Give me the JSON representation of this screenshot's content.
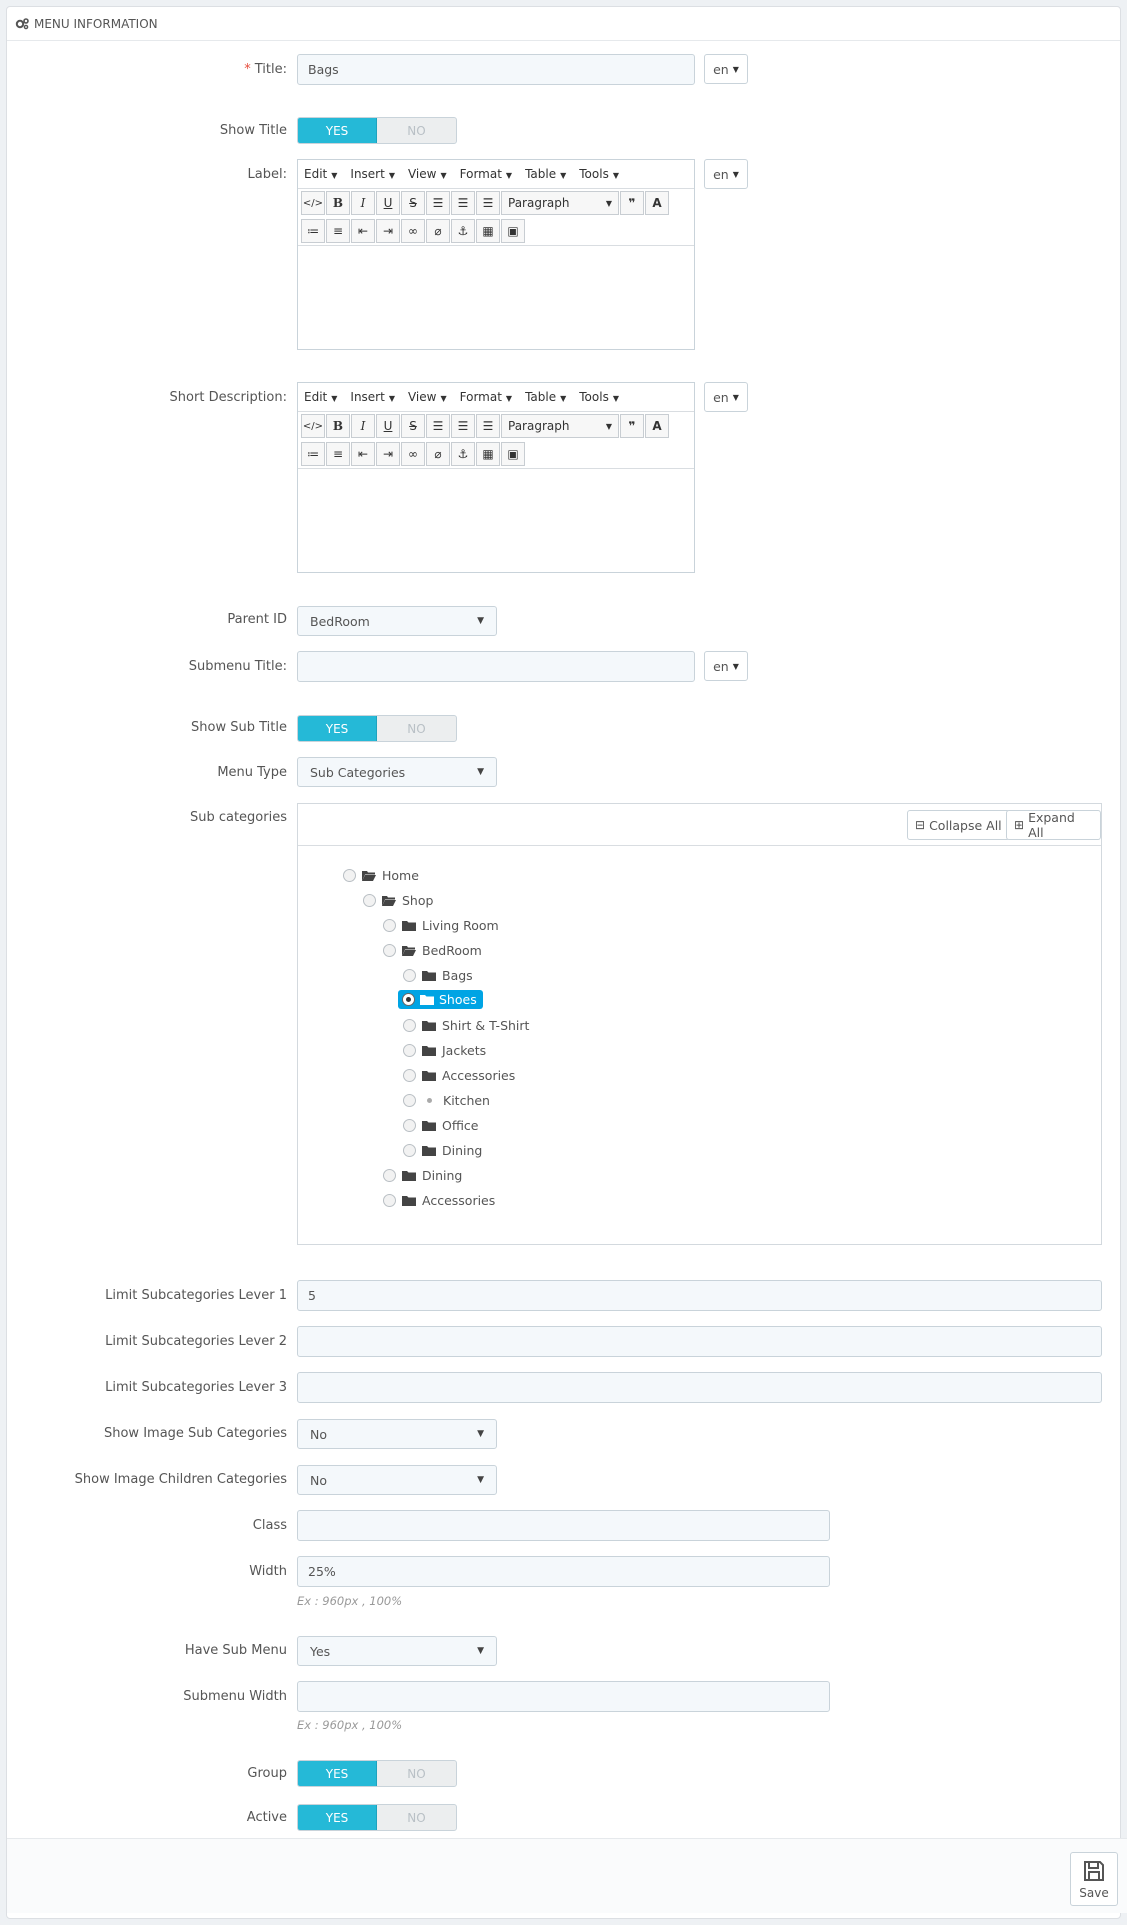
{
  "panel": {
    "heading": "MENU INFORMATION"
  },
  "lang": "en",
  "toggle": {
    "yes": "YES",
    "no": "NO"
  },
  "editor": {
    "menus": [
      "Edit",
      "Insert",
      "View",
      "Format",
      "Table",
      "Tools"
    ],
    "format_select": "Paragraph"
  },
  "fields": {
    "title": {
      "label": "Title:",
      "value": "Bags"
    },
    "show_title": {
      "label": "Show Title"
    },
    "label": {
      "label": "Label:"
    },
    "short_description": {
      "label": "Short Description:"
    },
    "parent_id": {
      "label": "Parent ID",
      "value": "BedRoom"
    },
    "submenu_title": {
      "label": "Submenu Title:",
      "value": ""
    },
    "show_sub_title": {
      "label": "Show Sub Title"
    },
    "menu_type": {
      "label": "Menu Type",
      "value": "Sub Categories"
    },
    "sub_categories": {
      "label": "Sub categories"
    },
    "limit1": {
      "label": "Limit Subcategories Lever 1",
      "value": "5"
    },
    "limit2": {
      "label": "Limit Subcategories Lever 2",
      "value": ""
    },
    "limit3": {
      "label": "Limit Subcategories Lever 3",
      "value": ""
    },
    "show_image_sub": {
      "label": "Show Image Sub Categories",
      "value": "No"
    },
    "show_image_children": {
      "label": "Show Image Children Categories",
      "value": "No"
    },
    "class": {
      "label": "Class",
      "value": ""
    },
    "width": {
      "label": "Width",
      "value": "25%",
      "help": "Ex : 960px , 100%"
    },
    "have_sub_menu": {
      "label": "Have Sub Menu",
      "value": "Yes"
    },
    "submenu_width": {
      "label": "Submenu Width",
      "value": "",
      "help": "Ex : 960px , 100%"
    },
    "group": {
      "label": "Group"
    },
    "active": {
      "label": "Active"
    }
  },
  "tree": {
    "collapse_all": "Collapse All",
    "expand_all": "Expand All",
    "nodes": [
      {
        "label": "Home"
      },
      {
        "label": "Shop"
      },
      {
        "label": "Living Room"
      },
      {
        "label": "BedRoom"
      },
      {
        "label": "Bags"
      },
      {
        "label": "Shoes"
      },
      {
        "label": "Shirt & T-Shirt"
      },
      {
        "label": "Jackets"
      },
      {
        "label": "Accessories"
      },
      {
        "label": "Kitchen"
      },
      {
        "label": "Office"
      },
      {
        "label": "Dining"
      },
      {
        "label": "Dining"
      },
      {
        "label": "Accessories"
      }
    ]
  },
  "footer": {
    "save": "Save"
  }
}
